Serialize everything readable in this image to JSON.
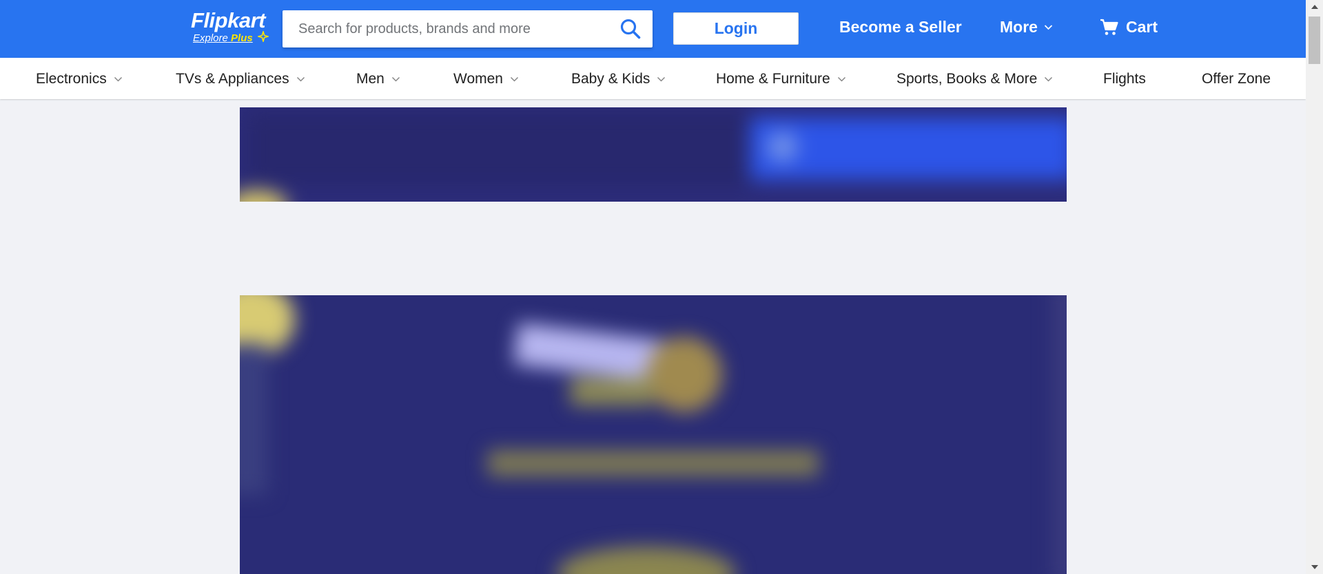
{
  "header": {
    "logo_text": "Flipkart",
    "logo_sub": "Explore",
    "logo_plus": "Plus",
    "search_placeholder": "Search for products, brands and more",
    "login_label": "Login",
    "seller_label": "Become a Seller",
    "more_label": "More",
    "cart_label": "Cart"
  },
  "categories": [
    {
      "label": "Electronics",
      "dropdown": true
    },
    {
      "label": "TVs & Appliances",
      "dropdown": true
    },
    {
      "label": "Men",
      "dropdown": true
    },
    {
      "label": "Women",
      "dropdown": true
    },
    {
      "label": "Baby & Kids",
      "dropdown": true
    },
    {
      "label": "Home & Furniture",
      "dropdown": true
    },
    {
      "label": "Sports, Books & More",
      "dropdown": true
    },
    {
      "label": "Flights",
      "dropdown": false
    },
    {
      "label": "Offer Zone",
      "dropdown": false
    }
  ],
  "colors": {
    "brand": "#2874f0",
    "logo_accent": "#ffe500",
    "page_bg": "#f1f2f6",
    "banner_bg": "#2c2c7a"
  },
  "icons": {
    "search": "search-icon",
    "cart": "cart-icon",
    "chevron": "chevron-down-icon"
  }
}
